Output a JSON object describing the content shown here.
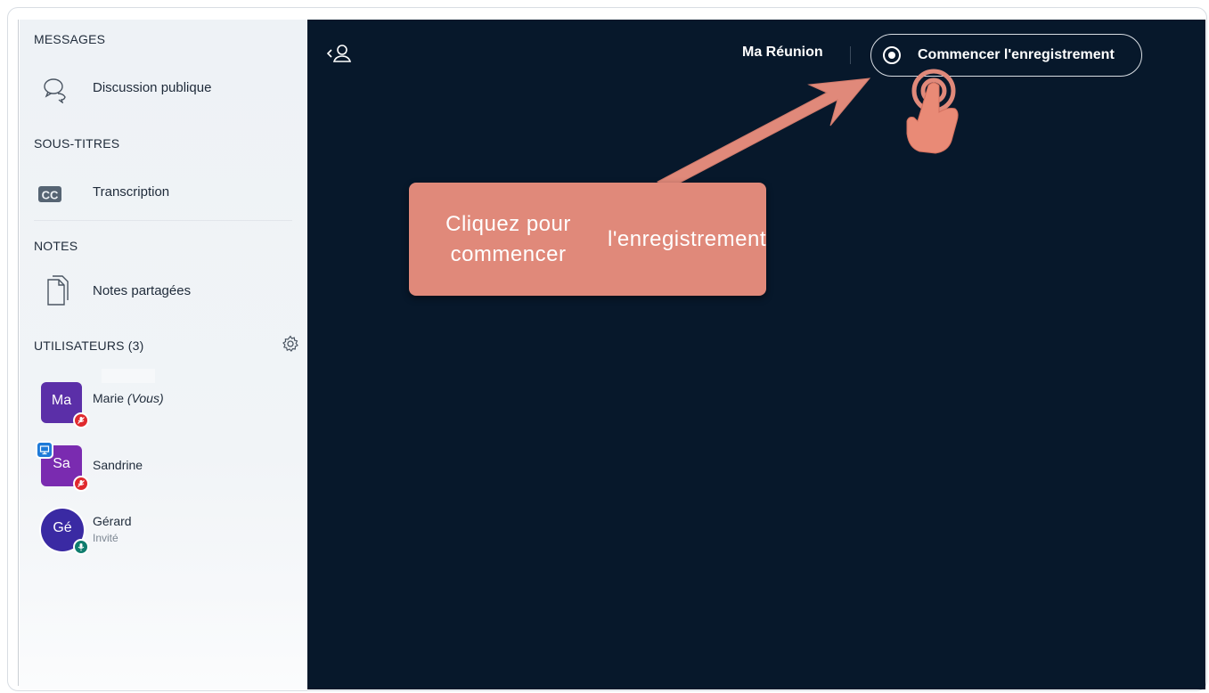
{
  "sidebar": {
    "messages_title": "MESSAGES",
    "public_chat_label": "Discussion publique",
    "captions_title": "SOUS-TITRES",
    "transcription_label": "Transcription",
    "notes_title": "NOTES",
    "shared_notes_label": "Notes partagées",
    "users_title": "UTILISATEURS (3)",
    "users": [
      {
        "initials": "Ma",
        "name": "Marie",
        "you_tag": "(Vous)",
        "role": "",
        "avatar_color": "#5b2fa8",
        "status": "muted",
        "presenter": false
      },
      {
        "initials": "Sa",
        "name": "Sandrine",
        "you_tag": "",
        "role": "",
        "avatar_color": "#7a2bb0",
        "status": "muted",
        "presenter": true
      },
      {
        "initials": "Gé",
        "name": "Gérard",
        "you_tag": "",
        "role": "Invité",
        "avatar_color": "#3a2aa3",
        "status": "mic-on",
        "presenter": false
      }
    ]
  },
  "header": {
    "meeting_title": "Ma Réunion",
    "record_label": "Commencer l'enregistrement"
  },
  "callout": {
    "text": "Cliquez pour commencer l'enregistrement"
  },
  "colors": {
    "main_bg": "#07182b",
    "callout_bg": "#e0897a",
    "muted_badge": "#e0292e",
    "mic_badge": "#0f7d6e",
    "presenter_badge": "#1e7ad8"
  }
}
